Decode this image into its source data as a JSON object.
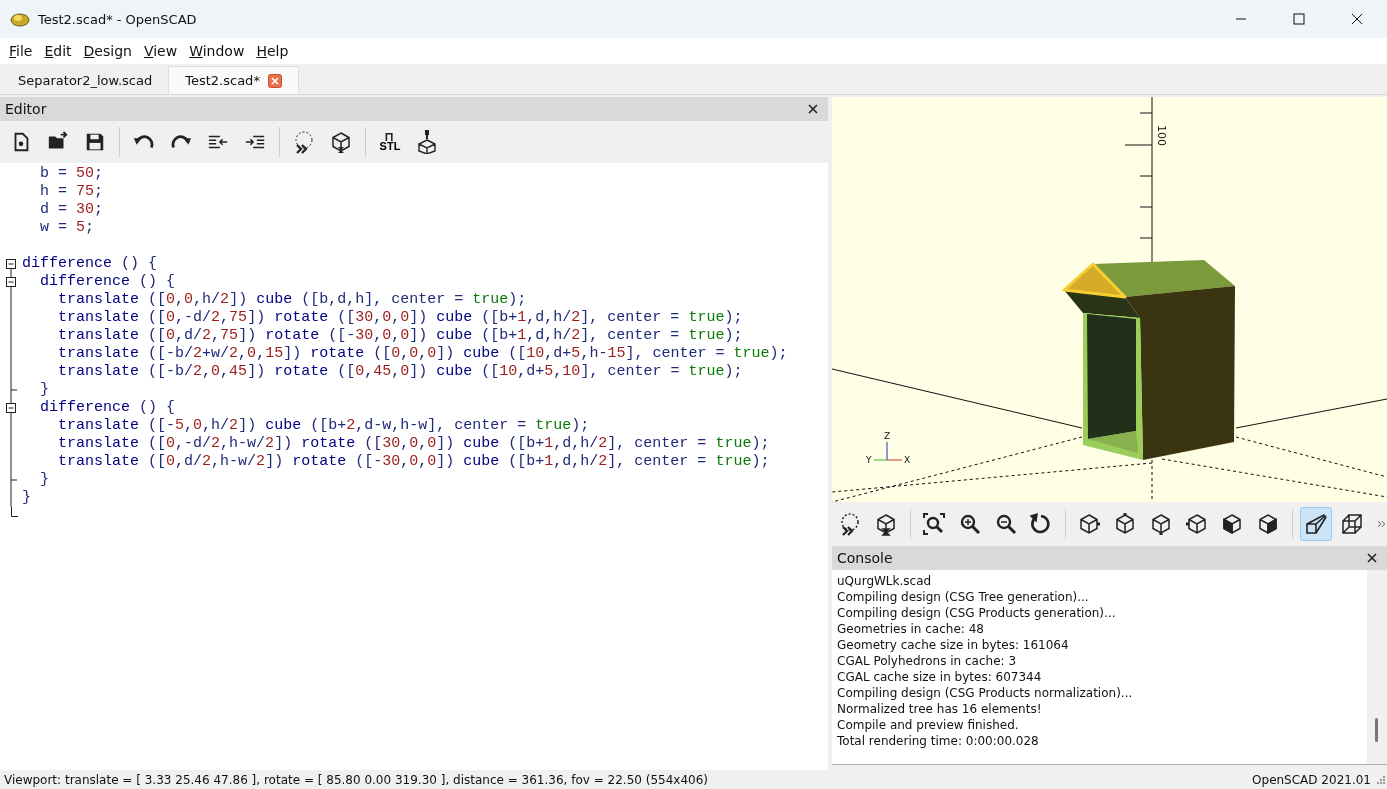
{
  "window": {
    "title": "Test2.scad* - OpenSCAD"
  },
  "menu": [
    "File",
    "Edit",
    "Design",
    "View",
    "Window",
    "Help"
  ],
  "tabs": [
    {
      "label": "Separator2_low.scad",
      "selected": false
    },
    {
      "label": "Test2.scad*",
      "selected": true
    }
  ],
  "editor": {
    "title": "Editor",
    "export_label": "STL",
    "lines": [
      {
        "kind": "plain",
        "tokens": [
          {
            "kind": "symbol",
            "text": "  b = "
          },
          {
            "kind": "number",
            "text": "50"
          },
          {
            "kind": "symbol",
            "text": ";"
          }
        ]
      },
      {
        "kind": "plain",
        "tokens": [
          {
            "kind": "symbol",
            "text": "  h = "
          },
          {
            "kind": "number",
            "text": "75"
          },
          {
            "kind": "symbol",
            "text": ";"
          }
        ]
      },
      {
        "kind": "plain",
        "tokens": [
          {
            "kind": "symbol",
            "text": "  d = "
          },
          {
            "kind": "number",
            "text": "30"
          },
          {
            "kind": "symbol",
            "text": ";"
          }
        ]
      },
      {
        "kind": "plain",
        "tokens": [
          {
            "kind": "symbol",
            "text": "  w = "
          },
          {
            "kind": "number",
            "text": "5"
          },
          {
            "kind": "symbol",
            "text": ";"
          }
        ]
      },
      {
        "kind": "plain"
      },
      {
        "kind": "fold_start",
        "tokens": [
          {
            "kind": "keyword",
            "text": "difference"
          },
          {
            "kind": "symbol",
            "text": " () {"
          }
        ]
      },
      {
        "kind": "nested_start",
        "tokens": [
          {
            "kind": "keyword",
            "text": "  difference"
          },
          {
            "kind": "symbol",
            "text": " () {"
          }
        ]
      },
      {
        "kind": "inside",
        "tokens": [
          {
            "kind": "keyword",
            "text": "    translate"
          },
          {
            "kind": "symbol",
            "text": " (["
          },
          {
            "kind": "number",
            "text": "0"
          },
          {
            "kind": "symbol",
            "text": ","
          },
          {
            "kind": "number",
            "text": "0"
          },
          {
            "kind": "symbol",
            "text": ",h/"
          },
          {
            "kind": "number",
            "text": "2"
          },
          {
            "kind": "symbol",
            "text": "]) "
          },
          {
            "kind": "keyword",
            "text": "cube"
          },
          {
            "kind": "symbol",
            "text": " ([b,d,h], center = "
          },
          {
            "kind": "boolean",
            "text": "true"
          },
          {
            "kind": "symbol",
            "text": ");"
          }
        ]
      },
      {
        "kind": "inside",
        "tokens": [
          {
            "kind": "keyword",
            "text": "    translate"
          },
          {
            "kind": "symbol",
            "text": " (["
          },
          {
            "kind": "number",
            "text": "0"
          },
          {
            "kind": "symbol",
            "text": ",-d/"
          },
          {
            "kind": "number",
            "text": "2"
          },
          {
            "kind": "symbol",
            "text": ","
          },
          {
            "kind": "number",
            "text": "75"
          },
          {
            "kind": "symbol",
            "text": "]) "
          },
          {
            "kind": "keyword",
            "text": "rotate"
          },
          {
            "kind": "symbol",
            "text": " (["
          },
          {
            "kind": "number",
            "text": "30"
          },
          {
            "kind": "symbol",
            "text": ","
          },
          {
            "kind": "number",
            "text": "0"
          },
          {
            "kind": "symbol",
            "text": ","
          },
          {
            "kind": "number",
            "text": "0"
          },
          {
            "kind": "symbol",
            "text": "]) "
          },
          {
            "kind": "keyword",
            "text": "cube"
          },
          {
            "kind": "symbol",
            "text": " ([b+"
          },
          {
            "kind": "number",
            "text": "1"
          },
          {
            "kind": "symbol",
            "text": ",d,h/"
          },
          {
            "kind": "number",
            "text": "2"
          },
          {
            "kind": "symbol",
            "text": "], center = "
          },
          {
            "kind": "boolean",
            "text": "true"
          },
          {
            "kind": "symbol",
            "text": ");"
          }
        ]
      },
      {
        "kind": "inside",
        "tokens": [
          {
            "kind": "keyword",
            "text": "    translate"
          },
          {
            "kind": "symbol",
            "text": " (["
          },
          {
            "kind": "number",
            "text": "0"
          },
          {
            "kind": "symbol",
            "text": ",d/"
          },
          {
            "kind": "number",
            "text": "2"
          },
          {
            "kind": "symbol",
            "text": ","
          },
          {
            "kind": "number",
            "text": "75"
          },
          {
            "kind": "symbol",
            "text": "]) "
          },
          {
            "kind": "keyword",
            "text": "rotate"
          },
          {
            "kind": "symbol",
            "text": " ([-"
          },
          {
            "kind": "number",
            "text": "30"
          },
          {
            "kind": "symbol",
            "text": ","
          },
          {
            "kind": "number",
            "text": "0"
          },
          {
            "kind": "symbol",
            "text": ","
          },
          {
            "kind": "number",
            "text": "0"
          },
          {
            "kind": "symbol",
            "text": "]) "
          },
          {
            "kind": "keyword",
            "text": "cube"
          },
          {
            "kind": "symbol",
            "text": " ([b+"
          },
          {
            "kind": "number",
            "text": "1"
          },
          {
            "kind": "symbol",
            "text": ",d,h/"
          },
          {
            "kind": "number",
            "text": "2"
          },
          {
            "kind": "symbol",
            "text": "], center = "
          },
          {
            "kind": "boolean",
            "text": "true"
          },
          {
            "kind": "symbol",
            "text": ");"
          }
        ]
      },
      {
        "kind": "inside",
        "tokens": [
          {
            "kind": "keyword",
            "text": "    translate"
          },
          {
            "kind": "symbol",
            "text": " ([-b/"
          },
          {
            "kind": "number",
            "text": "2"
          },
          {
            "kind": "symbol",
            "text": "+w/"
          },
          {
            "kind": "number",
            "text": "2"
          },
          {
            "kind": "symbol",
            "text": ","
          },
          {
            "kind": "number",
            "text": "0"
          },
          {
            "kind": "symbol",
            "text": ","
          },
          {
            "kind": "number",
            "text": "15"
          },
          {
            "kind": "symbol",
            "text": "]) "
          },
          {
            "kind": "keyword",
            "text": "rotate"
          },
          {
            "kind": "symbol",
            "text": " (["
          },
          {
            "kind": "number",
            "text": "0"
          },
          {
            "kind": "symbol",
            "text": ","
          },
          {
            "kind": "number",
            "text": "0"
          },
          {
            "kind": "symbol",
            "text": ","
          },
          {
            "kind": "number",
            "text": "0"
          },
          {
            "kind": "symbol",
            "text": "]) "
          },
          {
            "kind": "keyword",
            "text": "cube"
          },
          {
            "kind": "symbol",
            "text": " (["
          },
          {
            "kind": "number",
            "text": "10"
          },
          {
            "kind": "symbol",
            "text": ",d+"
          },
          {
            "kind": "number",
            "text": "5"
          },
          {
            "kind": "symbol",
            "text": ",h-"
          },
          {
            "kind": "number",
            "text": "15"
          },
          {
            "kind": "symbol",
            "text": "], center = "
          },
          {
            "kind": "boolean",
            "text": "true"
          },
          {
            "kind": "symbol",
            "text": ");"
          }
        ]
      },
      {
        "kind": "inside",
        "tokens": [
          {
            "kind": "keyword",
            "text": "    translate"
          },
          {
            "kind": "symbol",
            "text": " ([-b/"
          },
          {
            "kind": "number",
            "text": "2"
          },
          {
            "kind": "symbol",
            "text": ","
          },
          {
            "kind": "number",
            "text": "0"
          },
          {
            "kind": "symbol",
            "text": ","
          },
          {
            "kind": "number",
            "text": "45"
          },
          {
            "kind": "symbol",
            "text": "]) "
          },
          {
            "kind": "keyword",
            "text": "rotate"
          },
          {
            "kind": "symbol",
            "text": " (["
          },
          {
            "kind": "number",
            "text": "0"
          },
          {
            "kind": "symbol",
            "text": ","
          },
          {
            "kind": "number",
            "text": "45"
          },
          {
            "kind": "symbol",
            "text": ","
          },
          {
            "kind": "number",
            "text": "0"
          },
          {
            "kind": "symbol",
            "text": "]) "
          },
          {
            "kind": "keyword",
            "text": "cube"
          },
          {
            "kind": "symbol",
            "text": " (["
          },
          {
            "kind": "number",
            "text": "10"
          },
          {
            "kind": "symbol",
            "text": ",d+"
          },
          {
            "kind": "number",
            "text": "5"
          },
          {
            "kind": "symbol",
            "text": ","
          },
          {
            "kind": "number",
            "text": "10"
          },
          {
            "kind": "symbol",
            "text": "], center = "
          },
          {
            "kind": "boolean",
            "text": "true"
          },
          {
            "kind": "symbol",
            "text": ");"
          }
        ]
      },
      {
        "kind": "nested_end",
        "tokens": [
          {
            "kind": "symbol",
            "text": "  }"
          }
        ]
      },
      {
        "kind": "nested_start",
        "tokens": [
          {
            "kind": "keyword",
            "text": "  difference"
          },
          {
            "kind": "symbol",
            "text": " () {"
          }
        ]
      },
      {
        "kind": "inside",
        "tokens": [
          {
            "kind": "keyword",
            "text": "    translate"
          },
          {
            "kind": "symbol",
            "text": " ([-"
          },
          {
            "kind": "number",
            "text": "5"
          },
          {
            "kind": "symbol",
            "text": ","
          },
          {
            "kind": "number",
            "text": "0"
          },
          {
            "kind": "symbol",
            "text": ",h/"
          },
          {
            "kind": "number",
            "text": "2"
          },
          {
            "kind": "symbol",
            "text": "]) "
          },
          {
            "kind": "keyword",
            "text": "cube"
          },
          {
            "kind": "symbol",
            "text": " ([b+"
          },
          {
            "kind": "number",
            "text": "2"
          },
          {
            "kind": "symbol",
            "text": ",d-w,h-w], center = "
          },
          {
            "kind": "boolean",
            "text": "true"
          },
          {
            "kind": "symbol",
            "text": ");"
          }
        ]
      },
      {
        "kind": "inside",
        "tokens": [
          {
            "kind": "keyword",
            "text": "    translate"
          },
          {
            "kind": "symbol",
            "text": " (["
          },
          {
            "kind": "number",
            "text": "0"
          },
          {
            "kind": "symbol",
            "text": ",-d/"
          },
          {
            "kind": "number",
            "text": "2"
          },
          {
            "kind": "symbol",
            "text": ",h-w/"
          },
          {
            "kind": "number",
            "text": "2"
          },
          {
            "kind": "symbol",
            "text": "]) "
          },
          {
            "kind": "keyword",
            "text": "rotate"
          },
          {
            "kind": "symbol",
            "text": " (["
          },
          {
            "kind": "number",
            "text": "30"
          },
          {
            "kind": "symbol",
            "text": ","
          },
          {
            "kind": "number",
            "text": "0"
          },
          {
            "kind": "symbol",
            "text": ","
          },
          {
            "kind": "number",
            "text": "0"
          },
          {
            "kind": "symbol",
            "text": "]) "
          },
          {
            "kind": "keyword",
            "text": "cube"
          },
          {
            "kind": "symbol",
            "text": " ([b+"
          },
          {
            "kind": "number",
            "text": "1"
          },
          {
            "kind": "symbol",
            "text": ",d,h/"
          },
          {
            "kind": "number",
            "text": "2"
          },
          {
            "kind": "symbol",
            "text": "], center = "
          },
          {
            "kind": "boolean",
            "text": "true"
          },
          {
            "kind": "symbol",
            "text": ");"
          }
        ]
      },
      {
        "kind": "inside",
        "tokens": [
          {
            "kind": "keyword",
            "text": "    translate"
          },
          {
            "kind": "symbol",
            "text": " (["
          },
          {
            "kind": "number",
            "text": "0"
          },
          {
            "kind": "symbol",
            "text": ",d/"
          },
          {
            "kind": "number",
            "text": "2"
          },
          {
            "kind": "symbol",
            "text": ",h-w/"
          },
          {
            "kind": "number",
            "text": "2"
          },
          {
            "kind": "symbol",
            "text": "]) "
          },
          {
            "kind": "keyword",
            "text": "rotate"
          },
          {
            "kind": "symbol",
            "text": " ([-"
          },
          {
            "kind": "number",
            "text": "30"
          },
          {
            "kind": "symbol",
            "text": ","
          },
          {
            "kind": "number",
            "text": "0"
          },
          {
            "kind": "symbol",
            "text": ","
          },
          {
            "kind": "number",
            "text": "0"
          },
          {
            "kind": "symbol",
            "text": "]) "
          },
          {
            "kind": "keyword",
            "text": "cube"
          },
          {
            "kind": "symbol",
            "text": " ([b+"
          },
          {
            "kind": "number",
            "text": "1"
          },
          {
            "kind": "symbol",
            "text": ",d,h/"
          },
          {
            "kind": "number",
            "text": "2"
          },
          {
            "kind": "symbol",
            "text": "], center = "
          },
          {
            "kind": "boolean",
            "text": "true"
          },
          {
            "kind": "symbol",
            "text": ");"
          }
        ]
      },
      {
        "kind": "nested_end",
        "tokens": [
          {
            "kind": "symbol",
            "text": "  }"
          }
        ]
      },
      {
        "kind": "inside",
        "tokens": [
          {
            "kind": "symbol",
            "text": "}"
          }
        ]
      },
      {
        "kind": "end"
      }
    ]
  },
  "viewport": {
    "z_tick_label": "100",
    "axis_labels": {
      "z": "Z",
      "y": "Y",
      "x": "X"
    }
  },
  "view_toolbar": [
    {
      "selected": false
    },
    {
      "selected": false
    },
    {
      "selected": false
    },
    {
      "selected": false
    },
    {
      "selected": false
    },
    {
      "selected": false
    },
    {
      "selected": false
    },
    {
      "selected": false
    },
    {
      "selected": false
    },
    {
      "selected": false
    },
    {
      "selected": false
    },
    {
      "selected": false
    },
    {
      "selected": true
    },
    {
      "selected": false
    }
  ],
  "console": {
    "title": "Console",
    "lines": [
      "uQurgWLk.scad",
      "Compiling design (CSG Tree generation)...",
      "Compiling design (CSG Products generation)...",
      "Geometries in cache: 48",
      "Geometry cache size in bytes: 161064",
      "CGAL Polyhedrons in cache: 3",
      "CGAL cache size in bytes: 607344",
      "Compiling design (CSG Products normalization)...",
      "Normalized tree has 16 elements!",
      "Compile and preview finished.",
      "Total rendering time: 0:00:00.028"
    ]
  },
  "status_bar": {
    "viewport_info": "Viewport: translate = [ 3.33 25.46 47.86 ], rotate = [ 85.80 0.00 319.30 ], distance = 361.36, fov = 22.50 (554x406)",
    "version": "OpenSCAD 2021.01"
  }
}
